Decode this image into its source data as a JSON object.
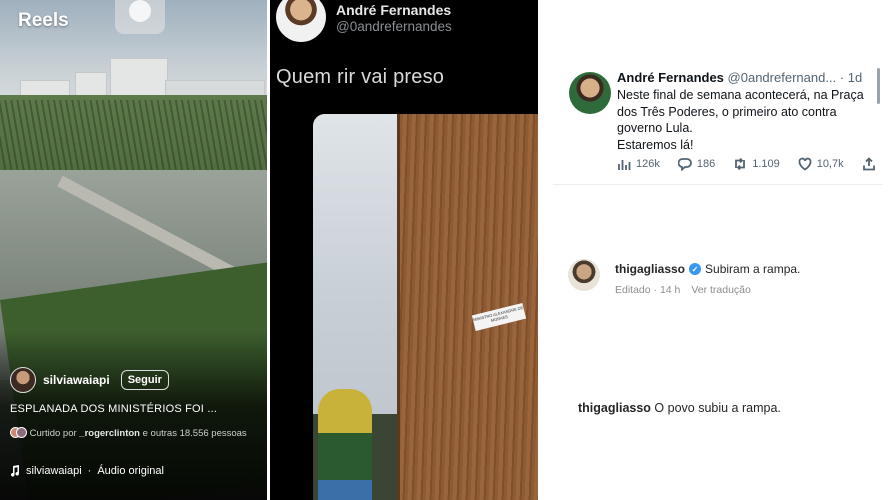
{
  "reels": {
    "title": "Reels",
    "username": "silviawaiapi",
    "follow_label": "Seguir",
    "caption": "ESPLANADA DOS MINISTÉRIOS FOI ...",
    "likes_prefix": "Curtido por",
    "likes_user": "_rogerclinton",
    "likes_suffix": "e outras 18.556 pessoas",
    "audio_user": "silviawaiapi",
    "audio_separator": "·",
    "audio_label": "Áudio original",
    "icons": [
      "camera-icon",
      "music-note-icon"
    ]
  },
  "dark_tweet": {
    "name": "André Fernandes",
    "handle": "@0andrefernandes",
    "text": "Quem rir vai preso",
    "sticker_text": "MINISTRO ALEXANDRE DE MORAES"
  },
  "light_tweet": {
    "name": "André Fernandes",
    "handle": "@0andrefernand...",
    "time": "· 1d",
    "body_lines": [
      "Neste final de semana acontecerá, na Praça",
      "dos Três Poderes, o primeiro ato contra",
      "governo Lula.",
      "Estaremos lá!"
    ],
    "views": "126k",
    "replies": "186",
    "retweets": "1.109",
    "likes": "10,7k",
    "icons": [
      "views-icon",
      "reply-icon",
      "retweet-icon",
      "like-icon",
      "share-icon"
    ]
  },
  "comments": {
    "first": {
      "username": "thigagliasso",
      "text": "Subiram a rampa.",
      "edited": "Editado · 14 h",
      "translate": "Ver tradução"
    },
    "second": {
      "username": "thigagliasso",
      "text": "O povo subiu a rampa."
    }
  },
  "colors": {
    "verified": "#3897f0",
    "muted": "#536471",
    "dark_bg": "#000000"
  }
}
